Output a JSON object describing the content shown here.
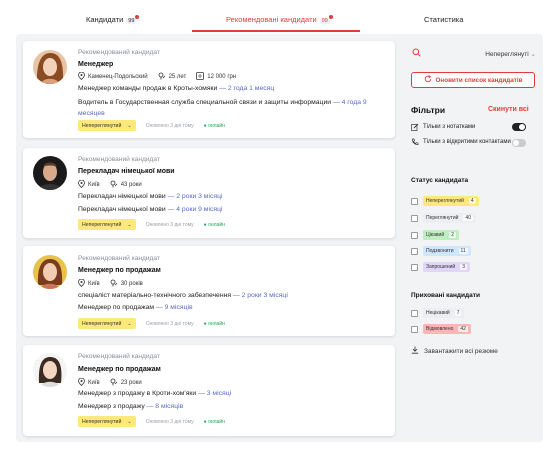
{
  "tabs": [
    {
      "label": "Кандидати",
      "count": "99"
    },
    {
      "label": "Рекомендовані кандидати",
      "count": "99"
    },
    {
      "label": "Статистика"
    }
  ],
  "cards": [
    {
      "tag": "Рекомендований кандидат",
      "title": "Менеджер",
      "city": "Каменец-Подольский",
      "age": "25 лет",
      "salary": "12 000 грн",
      "exp": [
        {
          "text": "Менеджер команды продаж в Кроты-хомяки",
          "dur": "— 2 года 1 месяц"
        },
        {
          "text": "Водитель в Государственная служба специальной связи и защиты информации",
          "dur": "— 4 года 9 месяцев"
        }
      ],
      "status": "Непереглянутий",
      "updated": "Оновлено 3 дні тому",
      "online": "онлайн"
    },
    {
      "tag": "Рекомендований кандидат",
      "title": "Перекладач німецької мови",
      "city": "Київ",
      "age": "43 роки",
      "exp": [
        {
          "text": "Перекладач німецької мови",
          "dur": "— 2 роки 3 місяці"
        },
        {
          "text": "Перекладач німецької мови",
          "dur": "— 4 роки 9 місяці"
        }
      ],
      "status": "Непереглянутий",
      "updated": "Оновлено 3 дні тому",
      "online": "онлайн"
    },
    {
      "tag": "Рекомендований кандидат",
      "title": "Менеджер по продажам",
      "city": "Київ",
      "age": "30 років",
      "exp": [
        {
          "text": "спеціаліст матеріально-технічного забезпечення",
          "dur": "— 2 роки 3 місяці"
        },
        {
          "text": "Менеджер по продажам",
          "dur": "— 9 місяців"
        }
      ],
      "status": "Непереглянутий",
      "updated": "Оновлено 3 дні тому",
      "online": "онлайн"
    },
    {
      "tag": "Рекомендований кандидат",
      "title": "Менеджер по продажам",
      "city": "Київ",
      "age": "23 роки",
      "exp": [
        {
          "text": "Менеджер з продажу в Кроти-хом'яки",
          "dur": "— 3 місяці"
        },
        {
          "text": "Менеджер з продажу",
          "dur": "— 8 місяців"
        }
      ],
      "status": "Непереглянутий",
      "updated": "Оновлено 3 дні тому",
      "online": "онлайн"
    }
  ],
  "sidebar": {
    "sort_value": "Непереглянуті",
    "refresh_label": "Оновити список кандидатів",
    "filters_title": "Фільтри",
    "reset_label": "Скинути всі",
    "filter_with_notes": "Тільки з нотатками",
    "filter_with_contacts": "Тільки з відкритими контактами",
    "status_title": "Статус кандидата",
    "statuses": [
      {
        "label": "Непереглянутий",
        "count": "4",
        "color": "#fde97a"
      },
      {
        "label": "Переглянутий",
        "count": "40",
        "color": "#eceef1"
      },
      {
        "label": "Цікавий",
        "count": "2",
        "color": "#bfeec0"
      },
      {
        "label": "Подзвонити",
        "count": "11",
        "color": "#cfe6fb"
      },
      {
        "label": "Запрошений",
        "count": "3",
        "color": "#e2d6f7"
      }
    ],
    "hidden_title": "Приховані кандидати",
    "hidden": [
      {
        "label": "Нецікавий",
        "count": "7",
        "color": "#eceef1"
      },
      {
        "label": "Відмовлено",
        "count": "42",
        "color": "#f8b6b6"
      }
    ],
    "download_label": "Завантажити всі резюме"
  },
  "colors": {
    "accent": "#e23b3b",
    "background": "#f2f3f5"
  }
}
